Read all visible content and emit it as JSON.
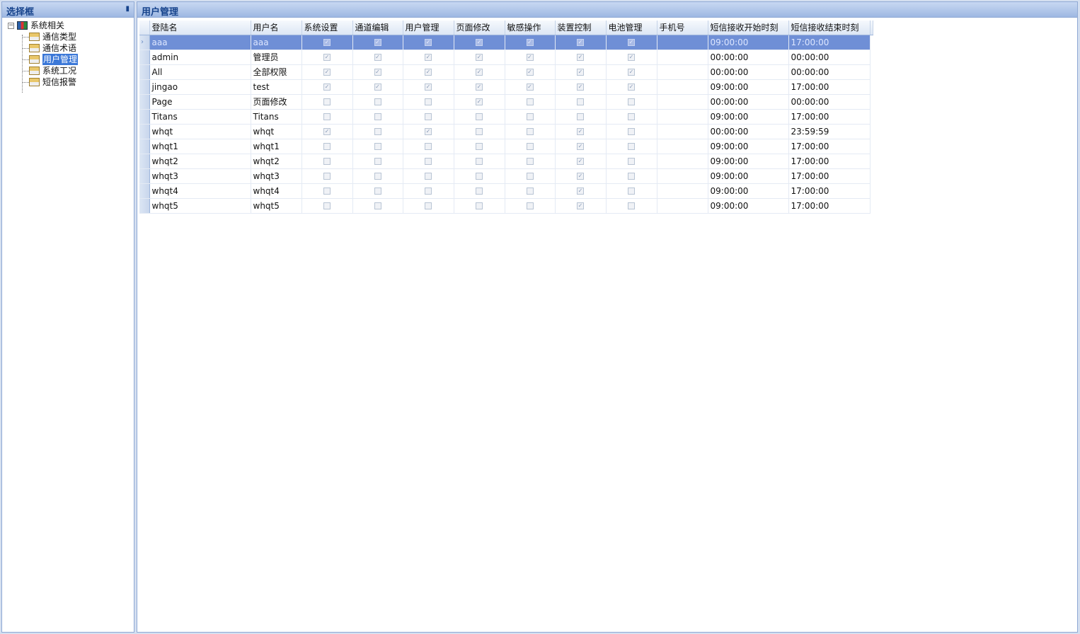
{
  "left_panel": {
    "title": "选择框",
    "tree": {
      "root": "系统相关",
      "children": [
        "通信类型",
        "通信术语",
        "用户管理",
        "系统工况",
        "短信报警"
      ],
      "selected": "用户管理"
    }
  },
  "right_panel": {
    "title": "用户管理"
  },
  "grid": {
    "columns": [
      "登陆名",
      "用户名",
      "系统设置",
      "通道编辑",
      "用户管理",
      "页面修改",
      "敏感操作",
      "装置控制",
      "电池管理",
      "手机号",
      "短信接收开始时刻",
      "短信接收结束时刻"
    ],
    "selected_row": 0,
    "rows": [
      {
        "login": "aaa",
        "user": "aaa",
        "perms": [
          1,
          1,
          1,
          1,
          1,
          1,
          1
        ],
        "phone": "",
        "start": "09:00:00",
        "end": "17:00:00"
      },
      {
        "login": "admin",
        "user": "管理员",
        "perms": [
          1,
          1,
          1,
          1,
          1,
          1,
          1
        ],
        "phone": "",
        "start": "00:00:00",
        "end": "00:00:00"
      },
      {
        "login": "All",
        "user": "全部权限",
        "perms": [
          1,
          1,
          1,
          1,
          1,
          1,
          1
        ],
        "phone": "",
        "start": "00:00:00",
        "end": "00:00:00"
      },
      {
        "login": "jingao",
        "user": "test",
        "perms": [
          1,
          1,
          1,
          1,
          1,
          1,
          1
        ],
        "phone": "",
        "start": "09:00:00",
        "end": "17:00:00"
      },
      {
        "login": "Page",
        "user": "页面修改",
        "perms": [
          0,
          0,
          0,
          1,
          0,
          0,
          0
        ],
        "phone": "",
        "start": "00:00:00",
        "end": "00:00:00"
      },
      {
        "login": "Titans",
        "user": "Titans",
        "perms": [
          0,
          0,
          0,
          0,
          0,
          0,
          0
        ],
        "phone": "",
        "start": "09:00:00",
        "end": "17:00:00"
      },
      {
        "login": "whqt",
        "user": "whqt",
        "perms": [
          1,
          0,
          1,
          0,
          0,
          1,
          0
        ],
        "phone": "",
        "start": "00:00:00",
        "end": "23:59:59"
      },
      {
        "login": "whqt1",
        "user": "whqt1",
        "perms": [
          0,
          0,
          0,
          0,
          0,
          1,
          0
        ],
        "phone": "",
        "start": "09:00:00",
        "end": "17:00:00"
      },
      {
        "login": "whqt2",
        "user": "whqt2",
        "perms": [
          0,
          0,
          0,
          0,
          0,
          1,
          0
        ],
        "phone": "",
        "start": "09:00:00",
        "end": "17:00:00"
      },
      {
        "login": "whqt3",
        "user": "whqt3",
        "perms": [
          0,
          0,
          0,
          0,
          0,
          1,
          0
        ],
        "phone": "",
        "start": "09:00:00",
        "end": "17:00:00"
      },
      {
        "login": "whqt4",
        "user": "whqt4",
        "perms": [
          0,
          0,
          0,
          0,
          0,
          1,
          0
        ],
        "phone": "",
        "start": "09:00:00",
        "end": "17:00:00"
      },
      {
        "login": "whqt5",
        "user": "whqt5",
        "perms": [
          0,
          0,
          0,
          0,
          0,
          1,
          0
        ],
        "phone": "",
        "start": "09:00:00",
        "end": "17:00:00"
      }
    ]
  }
}
